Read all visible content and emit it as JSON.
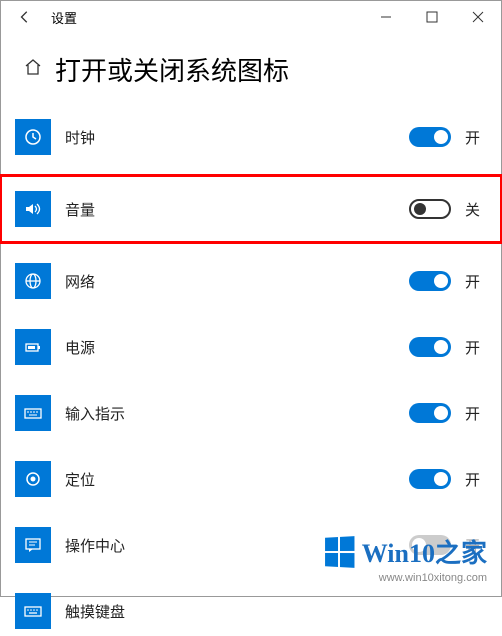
{
  "titlebar": {
    "title": "设置"
  },
  "header": {
    "title": "打开或关闭系统图标"
  },
  "labels": {
    "on": "开",
    "off": "关"
  },
  "items": [
    {
      "id": "clock",
      "label": "时钟",
      "state": "on",
      "interactable": true
    },
    {
      "id": "volume",
      "label": "音量",
      "state": "off",
      "interactable": true,
      "highlight": true
    },
    {
      "id": "network",
      "label": "网络",
      "state": "on",
      "interactable": true
    },
    {
      "id": "power",
      "label": "电源",
      "state": "on",
      "interactable": true
    },
    {
      "id": "input-indicator",
      "label": "输入指示",
      "state": "on",
      "interactable": true
    },
    {
      "id": "location",
      "label": "定位",
      "state": "on",
      "interactable": true
    },
    {
      "id": "action-center",
      "label": "操作中心",
      "state": "disabled",
      "interactable": false
    },
    {
      "id": "touch-keyboard",
      "label": "触摸键盘",
      "state": "",
      "interactable": true
    }
  ],
  "watermark": {
    "brand": "Win10之家",
    "url": "www.win10xitong.com"
  }
}
